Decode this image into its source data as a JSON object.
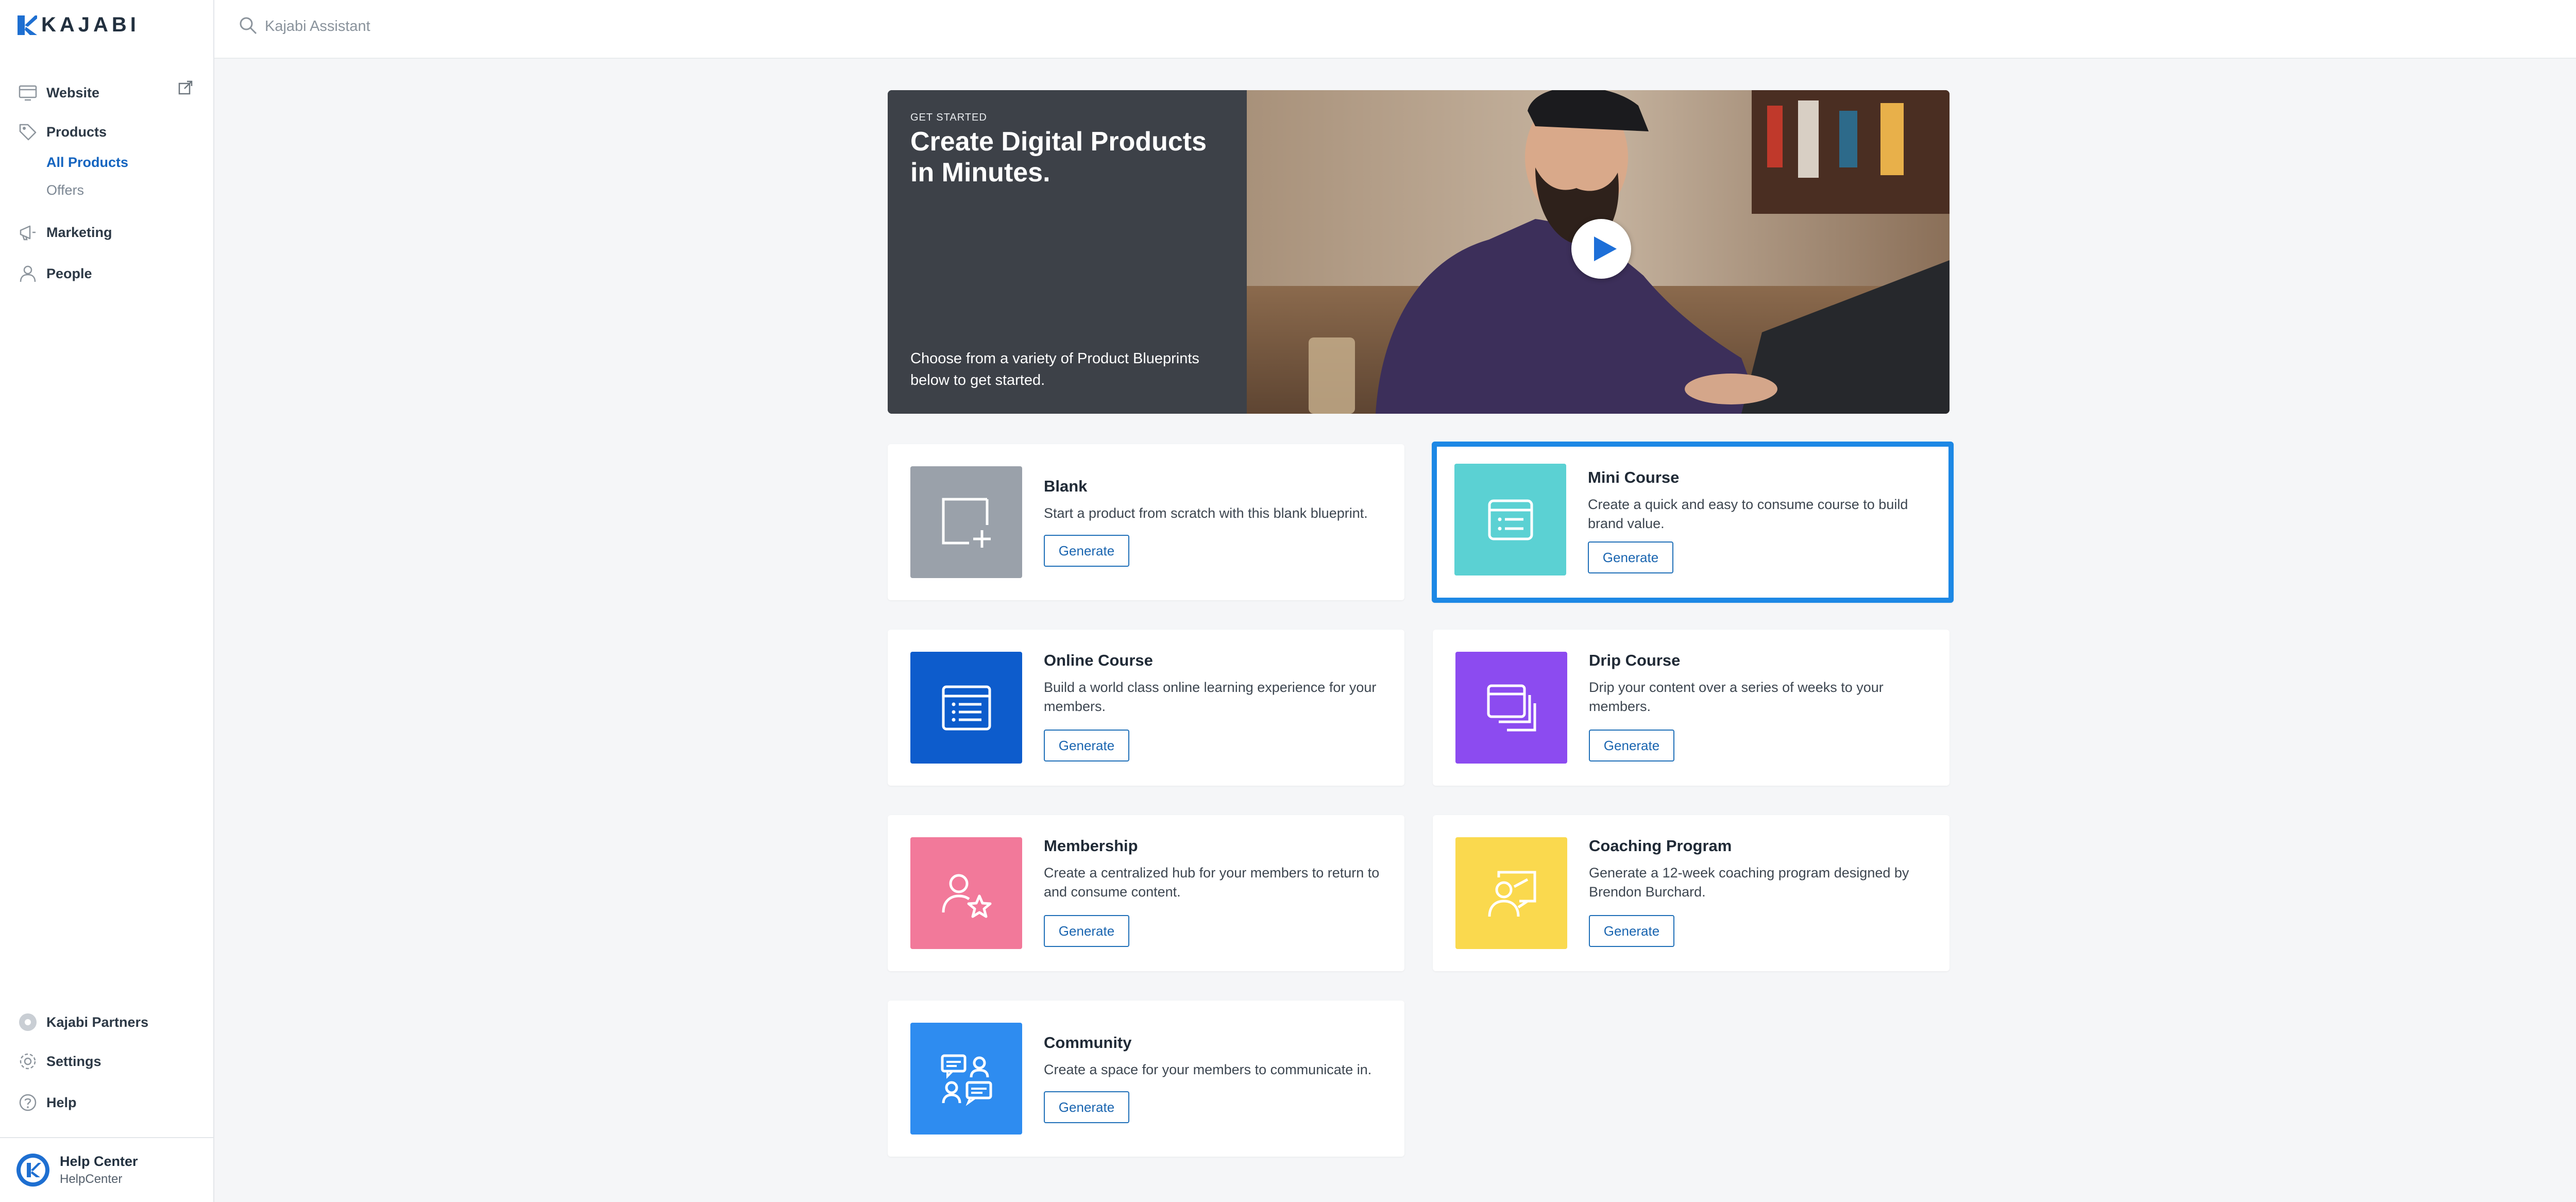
{
  "app": {
    "brand": "KAJABI"
  },
  "search": {
    "placeholder": "Kajabi Assistant"
  },
  "sidebar": {
    "items": [
      {
        "label": "Website"
      },
      {
        "label": "Products"
      },
      {
        "label": "Marketing"
      },
      {
        "label": "People"
      }
    ],
    "sub_items": [
      {
        "label": "All Products",
        "active": true
      },
      {
        "label": "Offers",
        "active": false
      }
    ],
    "bottom_items": [
      {
        "label": "Kajabi Partners"
      },
      {
        "label": "Settings"
      },
      {
        "label": "Help"
      }
    ],
    "footer": {
      "name": "Help Center",
      "sub": "HelpCenter"
    }
  },
  "hero": {
    "eyebrow": "GET STARTED",
    "title": "Create Digital Products in Minutes.",
    "description": "Choose from a variety of Product Blueprints below to get started."
  },
  "blueprints": [
    {
      "title": "Blank",
      "description": "Start a product from scratch with this blank blueprint.",
      "button": "Generate",
      "color": "#9aa1aa",
      "icon": "blank-add-icon"
    },
    {
      "title": "Mini Course",
      "description": "Create a quick and easy to consume course to build brand value.",
      "button": "Generate",
      "color": "#5bd1d3",
      "icon": "mini-course-icon",
      "selected": true
    },
    {
      "title": "Online Course",
      "description": "Build a world class online learning experience for your members.",
      "button": "Generate",
      "color": "#0d5ccc",
      "icon": "online-course-icon"
    },
    {
      "title": "Drip Course",
      "description": "Drip your content over a series of weeks to your members.",
      "button": "Generate",
      "color": "#8c4bf0",
      "icon": "drip-course-icon"
    },
    {
      "title": "Membership",
      "description": "Create a centralized hub for your members to return to and consume content.",
      "button": "Generate",
      "color": "#f2799a",
      "icon": "membership-icon"
    },
    {
      "title": "Coaching Program",
      "description": "Generate a 12-week coaching program designed by Brendon Burchard.",
      "button": "Generate",
      "color": "#fad94e",
      "icon": "coaching-icon"
    },
    {
      "title": "Community",
      "description": "Create a space for your members to communicate in.",
      "button": "Generate",
      "color": "#2e8cf0",
      "icon": "community-icon"
    }
  ],
  "colors": {
    "accent": "#1565c0",
    "selection": "#1d88e5",
    "button_border": "#1f6fb8"
  }
}
